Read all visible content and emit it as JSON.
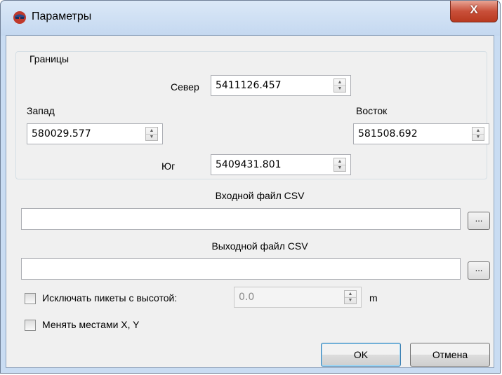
{
  "window": {
    "title": "Параметры",
    "close_label": "X",
    "icon": "app-globe-icon"
  },
  "bounds": {
    "group_title": "Границы",
    "north": {
      "label": "Север",
      "value": "5411126.457"
    },
    "west": {
      "label": "Запад",
      "value": "580029.577"
    },
    "east": {
      "label": "Восток",
      "value": "581508.692"
    },
    "south": {
      "label": "Юг",
      "value": "5409431.801"
    }
  },
  "input_csv": {
    "label": "Входной файл CSV",
    "value": "",
    "browse_label": "..."
  },
  "output_csv": {
    "label": "Выходной файл CSV",
    "value": "",
    "browse_label": "..."
  },
  "exclude": {
    "label": "Исключать пикеты с высотой:",
    "checked": false,
    "value": "0.0",
    "unit": "m"
  },
  "swap_xy": {
    "label": "Менять местами X, Y",
    "checked": false
  },
  "buttons": {
    "ok": "OK",
    "cancel": "Отмена"
  },
  "colors": {
    "titlebar": "#c9dcf2",
    "close": "#c9503a",
    "dialog_bg": "#f0f0f0",
    "default_button_border": "#3c7fb1"
  }
}
